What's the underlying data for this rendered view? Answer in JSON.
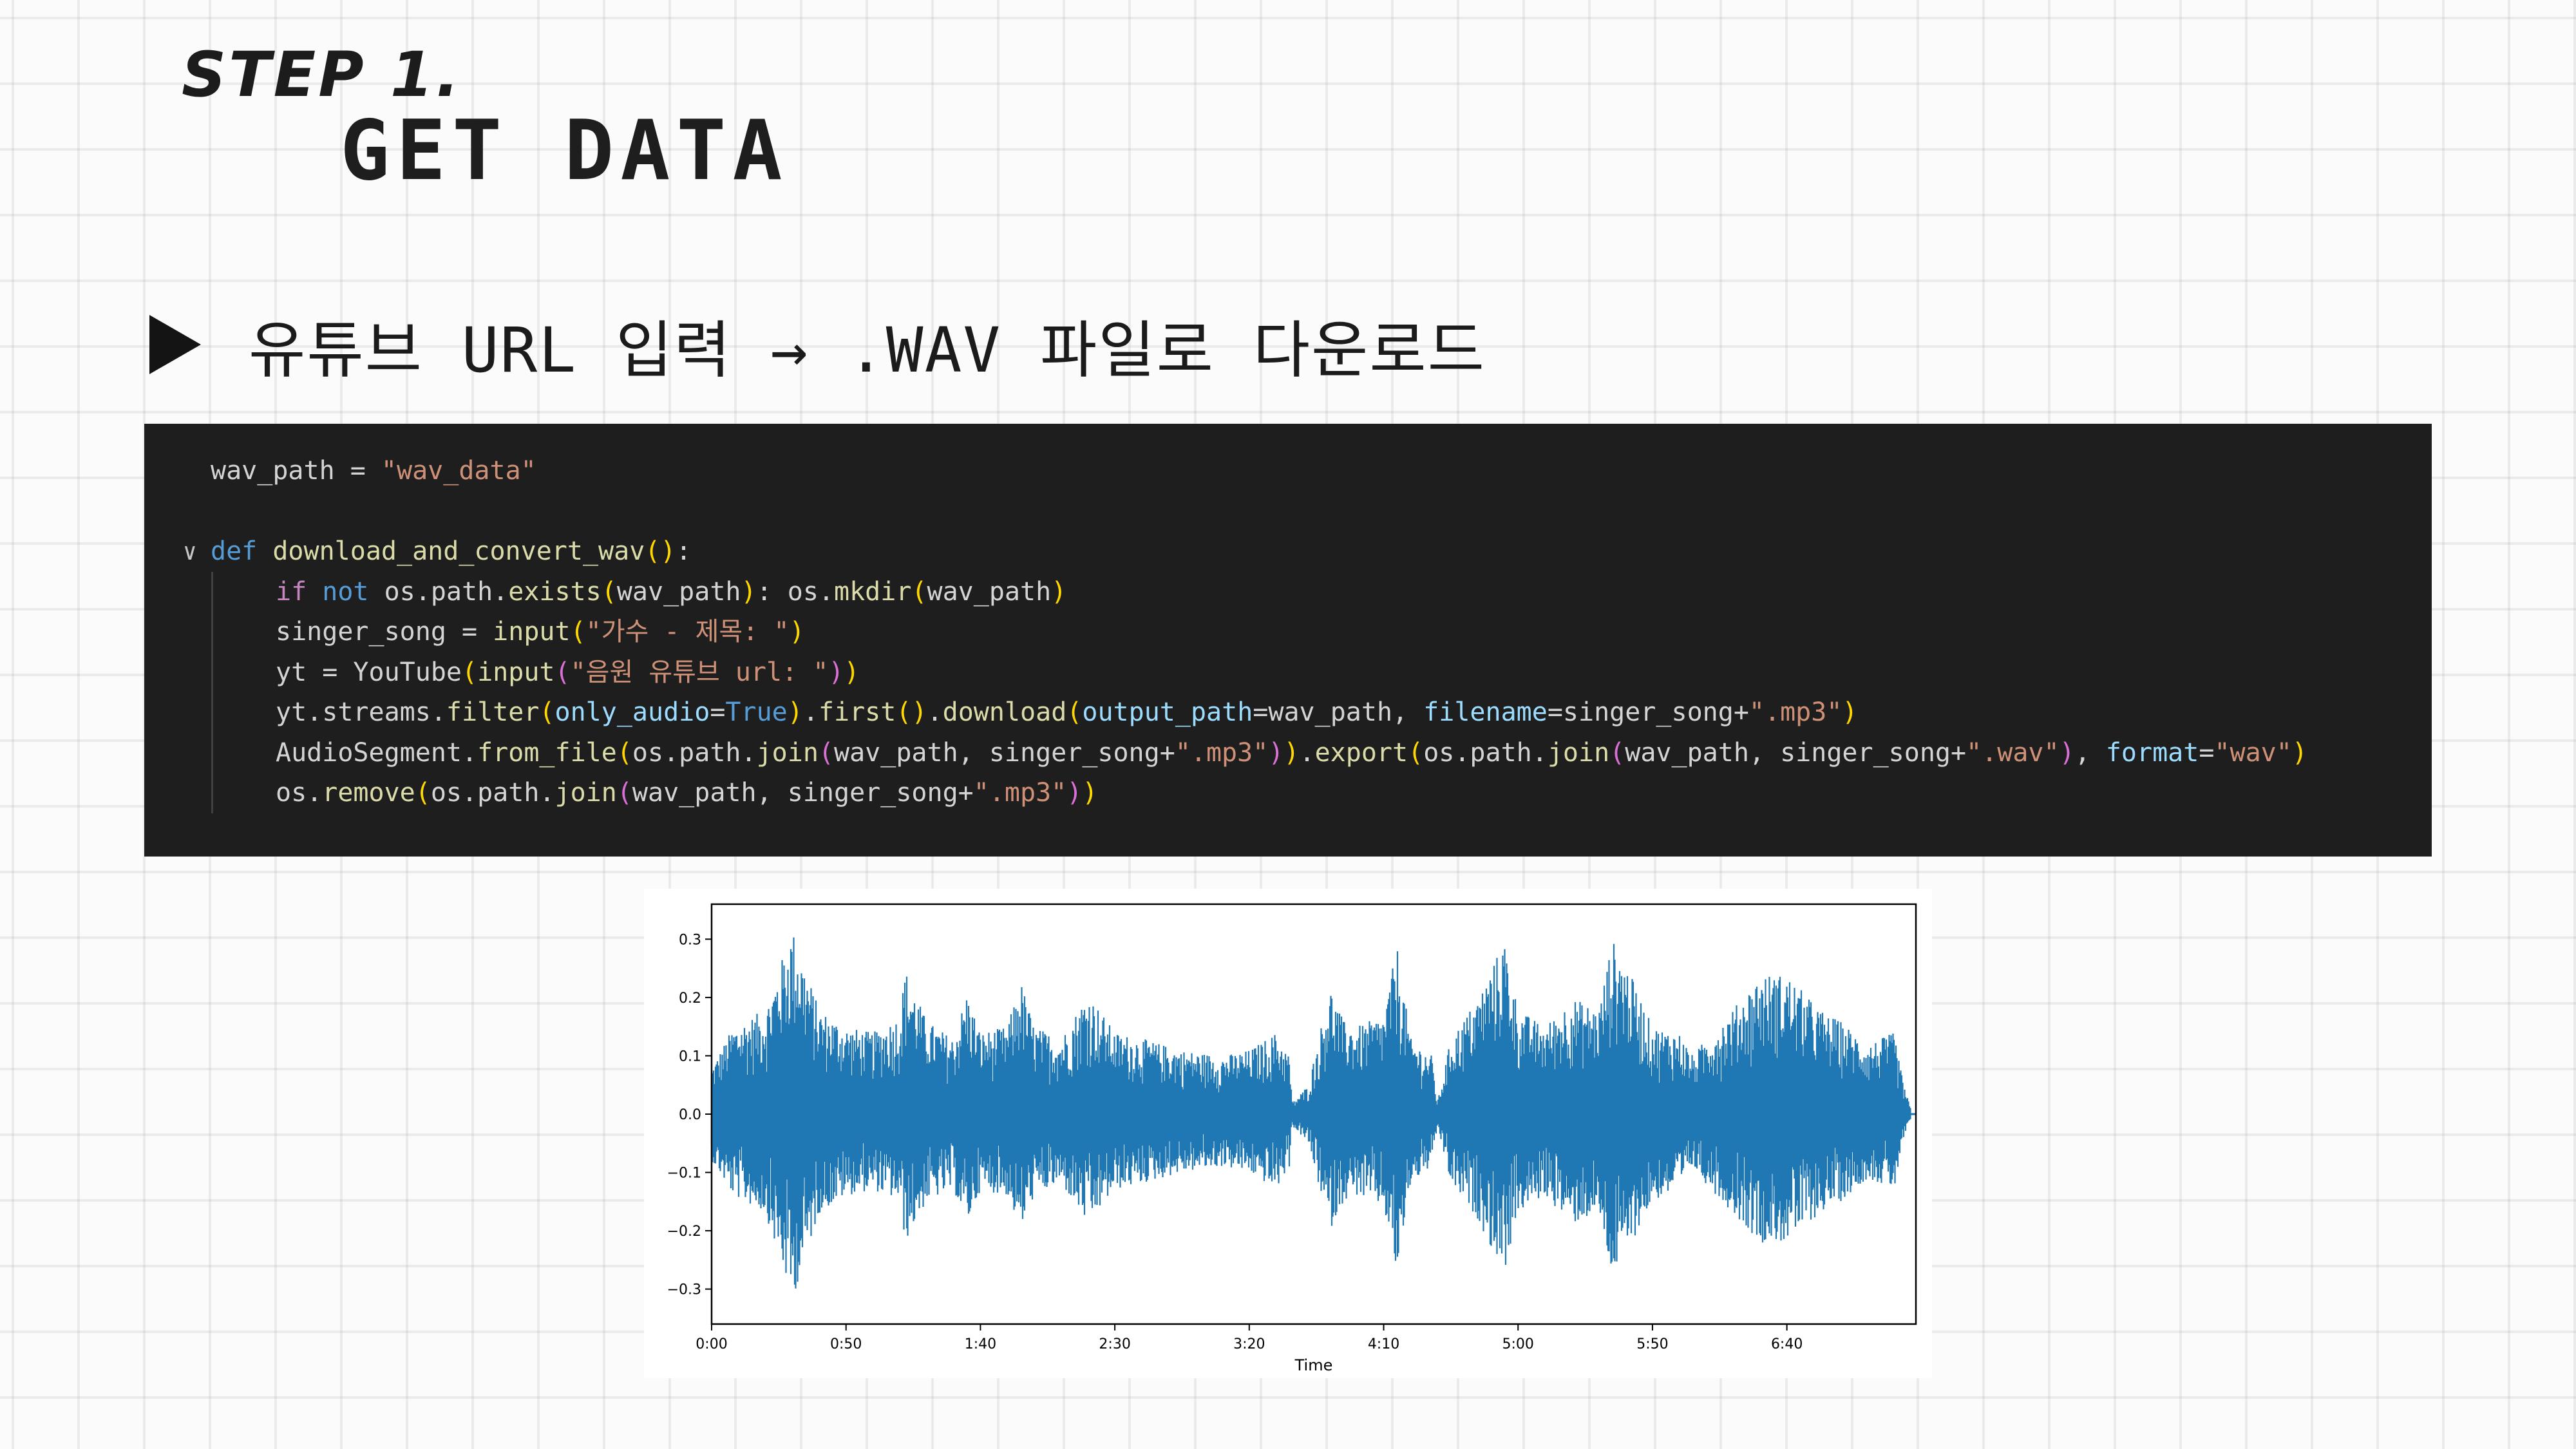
{
  "slide": {
    "step_label": "STEP 1.",
    "step_title": "GET DATA",
    "bullet_text": "유튜브 URL 입력 → .WAV 파일로 다운로드"
  },
  "icons": {
    "bullet": "play-triangle-icon",
    "fold": "chevron-down-icon"
  },
  "colors": {
    "code_bg": "#1e1e1e",
    "waveform": "#1f77b4"
  },
  "code": {
    "lines": [
      [
        {
          "t": "wav_path = ",
          "c": ""
        },
        {
          "t": "\"wav_data\"",
          "c": "str"
        }
      ],
      [],
      [
        {
          "t": "def ",
          "c": "kw"
        },
        {
          "t": "download_and_convert_wav",
          "c": "fn"
        },
        {
          "t": "()",
          "c": "p1"
        },
        {
          "t": ":",
          "c": ""
        }
      ],
      [
        {
          "t": "if ",
          "c": "kw2"
        },
        {
          "t": "not ",
          "c": "kw"
        },
        {
          "t": "os.path.",
          "c": ""
        },
        {
          "t": "exists",
          "c": "fn"
        },
        {
          "t": "(",
          "c": "p1"
        },
        {
          "t": "wav_path",
          "c": ""
        },
        {
          "t": ")",
          "c": "p1"
        },
        {
          "t": ": os.",
          "c": ""
        },
        {
          "t": "mkdir",
          "c": "fn"
        },
        {
          "t": "(",
          "c": "p1"
        },
        {
          "t": "wav_path",
          "c": ""
        },
        {
          "t": ")",
          "c": "p1"
        }
      ],
      [
        {
          "t": "singer_song = ",
          "c": ""
        },
        {
          "t": "input",
          "c": "fn"
        },
        {
          "t": "(",
          "c": "p1"
        },
        {
          "t": "\"가수 - 제목: \"",
          "c": "str"
        },
        {
          "t": ")",
          "c": "p1"
        }
      ],
      [
        {
          "t": "yt = YouTube",
          "c": ""
        },
        {
          "t": "(",
          "c": "p1"
        },
        {
          "t": "input",
          "c": "fn"
        },
        {
          "t": "(",
          "c": "p2"
        },
        {
          "t": "\"음원 유튜브 url: \"",
          "c": "str"
        },
        {
          "t": ")",
          "c": "p2"
        },
        {
          "t": ")",
          "c": "p1"
        }
      ],
      [
        {
          "t": "yt.streams.",
          "c": ""
        },
        {
          "t": "filter",
          "c": "fn"
        },
        {
          "t": "(",
          "c": "p1"
        },
        {
          "t": "only_audio",
          "c": "param"
        },
        {
          "t": "=",
          "c": ""
        },
        {
          "t": "True",
          "c": "kw"
        },
        {
          "t": ")",
          "c": "p1"
        },
        {
          "t": ".",
          "c": ""
        },
        {
          "t": "first",
          "c": "fn"
        },
        {
          "t": "()",
          "c": "p1"
        },
        {
          "t": ".",
          "c": ""
        },
        {
          "t": "download",
          "c": "fn"
        },
        {
          "t": "(",
          "c": "p1"
        },
        {
          "t": "output_path",
          "c": "param"
        },
        {
          "t": "=wav_path, ",
          "c": ""
        },
        {
          "t": "filename",
          "c": "param"
        },
        {
          "t": "=singer_song+",
          "c": ""
        },
        {
          "t": "\".mp3\"",
          "c": "str"
        },
        {
          "t": ")",
          "c": "p1"
        }
      ],
      [
        {
          "t": "AudioSegment.",
          "c": ""
        },
        {
          "t": "from_file",
          "c": "fn"
        },
        {
          "t": "(",
          "c": "p1"
        },
        {
          "t": "os.path.",
          "c": ""
        },
        {
          "t": "join",
          "c": "fn"
        },
        {
          "t": "(",
          "c": "p2"
        },
        {
          "t": "wav_path, singer_song+",
          "c": ""
        },
        {
          "t": "\".mp3\"",
          "c": "str"
        },
        {
          "t": ")",
          "c": "p2"
        },
        {
          "t": ")",
          "c": "p1"
        },
        {
          "t": ".",
          "c": ""
        },
        {
          "t": "export",
          "c": "fn"
        },
        {
          "t": "(",
          "c": "p1"
        },
        {
          "t": "os.path.",
          "c": ""
        },
        {
          "t": "join",
          "c": "fn"
        },
        {
          "t": "(",
          "c": "p2"
        },
        {
          "t": "wav_path, singer_song+",
          "c": ""
        },
        {
          "t": "\".wav\"",
          "c": "str"
        },
        {
          "t": ")",
          "c": "p2"
        },
        {
          "t": ", ",
          "c": ""
        },
        {
          "t": "format",
          "c": "param"
        },
        {
          "t": "=",
          "c": ""
        },
        {
          "t": "\"wav\"",
          "c": "str"
        },
        {
          "t": ")",
          "c": "p1"
        }
      ],
      [
        {
          "t": "os.",
          "c": ""
        },
        {
          "t": "remove",
          "c": "fn"
        },
        {
          "t": "(",
          "c": "p1"
        },
        {
          "t": "os.path.",
          "c": ""
        },
        {
          "t": "join",
          "c": "fn"
        },
        {
          "t": "(",
          "c": "p2"
        },
        {
          "t": "wav_path, singer_song+",
          "c": ""
        },
        {
          "t": "\".mp3\"",
          "c": "str"
        },
        {
          "t": ")",
          "c": "p2"
        },
        {
          "t": ")",
          "c": "p1"
        }
      ]
    ]
  },
  "chart_data": {
    "type": "area",
    "title": "",
    "xlabel": "Time",
    "ylabel": "",
    "x_tick_labels": [
      "0:00",
      "0:50",
      "1:40",
      "2:30",
      "3:20",
      "4:10",
      "5:00",
      "5:50",
      "6:40"
    ],
    "x_tick_seconds": [
      0,
      50,
      100,
      150,
      200,
      250,
      300,
      350,
      400
    ],
    "xlim_seconds": [
      0,
      448
    ],
    "y_tick_labels": [
      "0.3",
      "0.2",
      "0.1",
      "0.0",
      "−0.1",
      "−0.2",
      "−0.3"
    ],
    "y_tick_values": [
      0.3,
      0.2,
      0.1,
      0.0,
      -0.1,
      -0.2,
      -0.3
    ],
    "ylim": [
      -0.36,
      0.36
    ],
    "grid": false,
    "series": [
      {
        "envelope_time_s": [
          0,
          8,
          20,
          30,
          40,
          50,
          60,
          70,
          72,
          80,
          90,
          95,
          100,
          110,
          115,
          120,
          130,
          140,
          150,
          160,
          175,
          190,
          200,
          210,
          215,
          216,
          222,
          230,
          235,
          240,
          250,
          255,
          260,
          268,
          270,
          275,
          285,
          290,
          295,
          300,
          310,
          320,
          330,
          335,
          340,
          350,
          360,
          365,
          370,
          380,
          390,
          400,
          410,
          415,
          420,
          430,
          440,
          443,
          446,
          448
        ],
        "envelope_upper": [
          0.08,
          0.15,
          0.18,
          0.32,
          0.18,
          0.15,
          0.14,
          0.17,
          0.25,
          0.16,
          0.13,
          0.21,
          0.14,
          0.15,
          0.23,
          0.15,
          0.13,
          0.21,
          0.14,
          0.13,
          0.11,
          0.1,
          0.11,
          0.14,
          0.1,
          0.02,
          0.05,
          0.22,
          0.16,
          0.15,
          0.17,
          0.29,
          0.13,
          0.1,
          0.02,
          0.13,
          0.2,
          0.25,
          0.3,
          0.18,
          0.15,
          0.2,
          0.18,
          0.3,
          0.26,
          0.15,
          0.14,
          0.1,
          0.13,
          0.18,
          0.24,
          0.24,
          0.19,
          0.17,
          0.16,
          0.12,
          0.14,
          0.06,
          0.01,
          0.0
        ],
        "envelope_lower": [
          -0.08,
          -0.14,
          -0.17,
          -0.32,
          -0.17,
          -0.14,
          -0.13,
          -0.15,
          -0.22,
          -0.15,
          -0.13,
          -0.19,
          -0.13,
          -0.14,
          -0.2,
          -0.14,
          -0.12,
          -0.19,
          -0.13,
          -0.12,
          -0.1,
          -0.09,
          -0.1,
          -0.13,
          -0.09,
          -0.02,
          -0.05,
          -0.2,
          -0.15,
          -0.14,
          -0.16,
          -0.28,
          -0.12,
          -0.09,
          -0.02,
          -0.12,
          -0.18,
          -0.23,
          -0.27,
          -0.17,
          -0.14,
          -0.19,
          -0.17,
          -0.28,
          -0.24,
          -0.15,
          -0.13,
          -0.09,
          -0.12,
          -0.17,
          -0.22,
          -0.22,
          -0.18,
          -0.16,
          -0.15,
          -0.11,
          -0.13,
          -0.05,
          -0.01,
          0.0
        ]
      }
    ]
  }
}
